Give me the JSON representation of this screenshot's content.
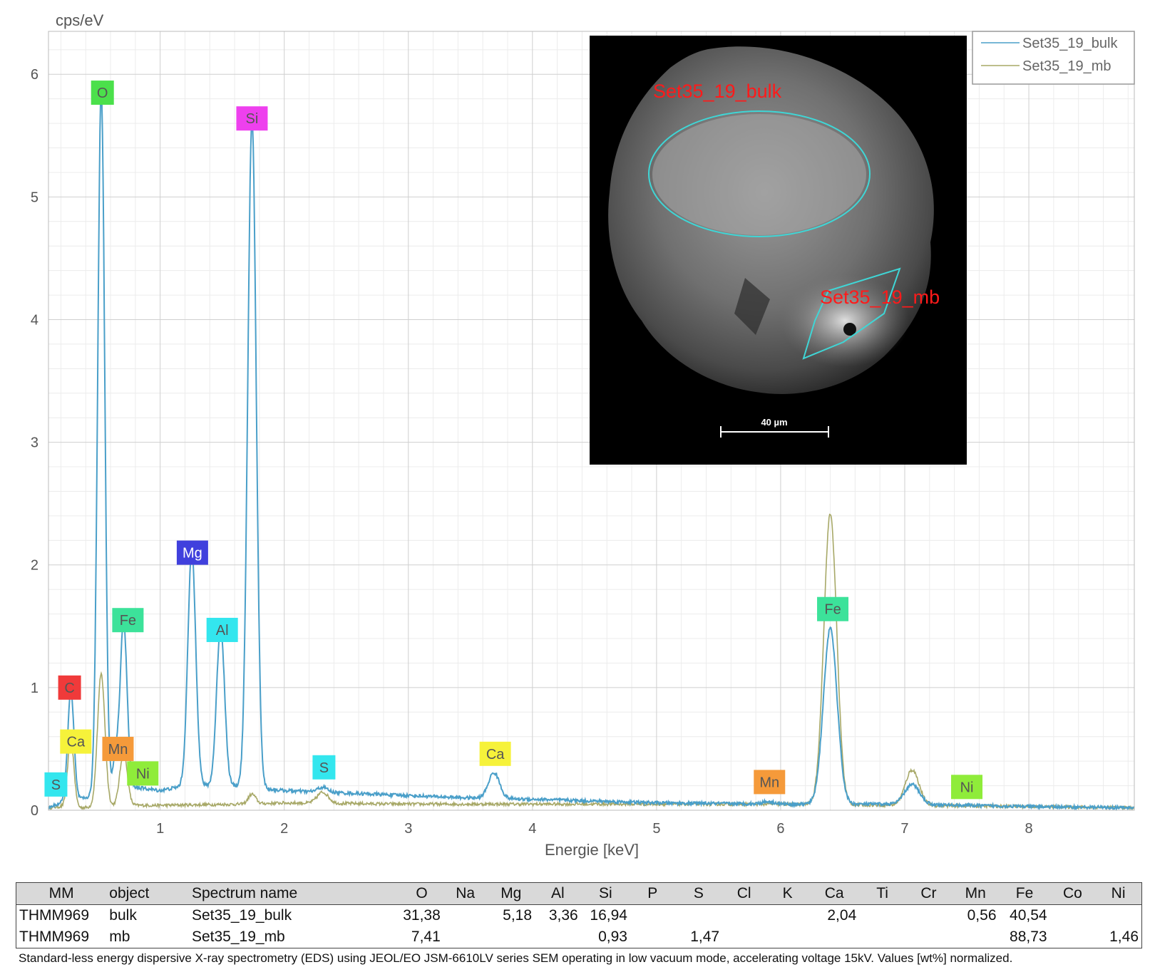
{
  "chart_data": {
    "type": "line",
    "xlabel": "Energie [keV]",
    "ylabel": "cps/eV",
    "xlim": [
      0.1,
      8.85
    ],
    "ylim": [
      0,
      6.35
    ],
    "x_ticks": [
      1,
      2,
      3,
      4,
      5,
      6,
      7,
      8
    ],
    "y_ticks": [
      0,
      1,
      2,
      3,
      4,
      5,
      6
    ],
    "grid": true,
    "legend_position": "top-right",
    "series": [
      {
        "name": "Set35_19_bulk",
        "color": "#4a9fc9",
        "baseline": [
          [
            0.1,
            0.02
          ],
          [
            0.2,
            0.06
          ],
          [
            0.4,
            0.1
          ],
          [
            0.7,
            0.2
          ],
          [
            1.0,
            0.16
          ],
          [
            1.2,
            0.2
          ],
          [
            1.6,
            0.2
          ],
          [
            1.9,
            0.17
          ],
          [
            2.0,
            0.16
          ],
          [
            2.5,
            0.14
          ],
          [
            3.0,
            0.12
          ],
          [
            3.5,
            0.1
          ],
          [
            4.0,
            0.09
          ],
          [
            5.0,
            0.06
          ],
          [
            6.0,
            0.05
          ],
          [
            7.0,
            0.05
          ],
          [
            8.0,
            0.03
          ],
          [
            8.85,
            0.02
          ]
        ],
        "peaks": [
          {
            "x": 0.28,
            "y": 0.9,
            "width": 0.025
          },
          {
            "x": 0.525,
            "y": 5.75,
            "width": 0.028
          },
          {
            "x": 0.64,
            "y": 0.25,
            "width": 0.02
          },
          {
            "x": 0.705,
            "y": 1.35,
            "width": 0.028
          },
          {
            "x": 1.255,
            "y": 1.92,
            "width": 0.032
          },
          {
            "x": 1.487,
            "y": 1.3,
            "width": 0.032
          },
          {
            "x": 1.74,
            "y": 5.45,
            "width": 0.034
          },
          {
            "x": 2.31,
            "y": 0.04,
            "width": 0.04
          },
          {
            "x": 3.69,
            "y": 0.21,
            "width": 0.045
          },
          {
            "x": 5.9,
            "y": 0.02,
            "width": 0.05
          },
          {
            "x": 6.4,
            "y": 1.43,
            "width": 0.055
          },
          {
            "x": 7.06,
            "y": 0.16,
            "width": 0.06
          }
        ]
      },
      {
        "name": "Set35_19_mb",
        "color": "#a7a867",
        "baseline": [
          [
            0.1,
            0.02
          ],
          [
            0.2,
            0.03
          ],
          [
            0.35,
            0.02
          ],
          [
            0.7,
            0.04
          ],
          [
            1.0,
            0.04
          ],
          [
            1.7,
            0.05
          ],
          [
            2.0,
            0.06
          ],
          [
            3.0,
            0.05
          ],
          [
            4.0,
            0.05
          ],
          [
            5.0,
            0.05
          ],
          [
            6.0,
            0.05
          ],
          [
            7.0,
            0.04
          ],
          [
            8.0,
            0.03
          ],
          [
            8.85,
            0.02
          ]
        ],
        "peaks": [
          {
            "x": 0.28,
            "y": 0.55,
            "width": 0.025
          },
          {
            "x": 0.525,
            "y": 1.08,
            "width": 0.03
          },
          {
            "x": 0.705,
            "y": 0.43,
            "width": 0.03
          },
          {
            "x": 1.74,
            "y": 0.08,
            "width": 0.03
          },
          {
            "x": 2.31,
            "y": 0.09,
            "width": 0.045
          },
          {
            "x": 6.4,
            "y": 2.37,
            "width": 0.052
          },
          {
            "x": 7.06,
            "y": 0.29,
            "width": 0.055
          }
        ]
      }
    ],
    "peak_labels": [
      {
        "text": "S",
        "x": 0.16,
        "y": 0.21,
        "color": "#33e6ee"
      },
      {
        "text": "C",
        "x": 0.27,
        "y": 1.0,
        "color": "#f03a3a"
      },
      {
        "text": "Ca",
        "x": 0.32,
        "y": 0.56,
        "color": "#f6f23a"
      },
      {
        "text": "O",
        "x": 0.535,
        "y": 5.85,
        "color": "#4be04b"
      },
      {
        "text": "Mn",
        "x": 0.66,
        "y": 0.5,
        "color": "#f59a3a"
      },
      {
        "text": "Fe",
        "x": 0.74,
        "y": 1.55,
        "color": "#3ce29a"
      },
      {
        "text": "Ni",
        "x": 0.86,
        "y": 0.3,
        "color": "#8fec3a"
      },
      {
        "text": "Mg",
        "x": 1.26,
        "y": 2.1,
        "color": "#4040dd"
      },
      {
        "text": "Al",
        "x": 1.5,
        "y": 1.47,
        "color": "#33e6ee"
      },
      {
        "text": "Si",
        "x": 1.74,
        "y": 5.64,
        "color": "#ee40ee"
      },
      {
        "text": "S",
        "x": 2.32,
        "y": 0.35,
        "color": "#33e6ee"
      },
      {
        "text": "Ca",
        "x": 3.7,
        "y": 0.46,
        "color": "#f6f23a"
      },
      {
        "text": "Mn",
        "x": 5.91,
        "y": 0.23,
        "color": "#f59a3a"
      },
      {
        "text": "Fe",
        "x": 6.42,
        "y": 1.64,
        "color": "#3ce29a"
      },
      {
        "text": "Ni",
        "x": 7.5,
        "y": 0.19,
        "color": "#8fec3a"
      }
    ]
  },
  "inset": {
    "region_labels": [
      "Set35_19_bulk",
      "Set35_19_mb"
    ],
    "scale_bar_label": "40 µm"
  },
  "table": {
    "headers": [
      "MM",
      "object",
      "Spectrum name",
      "O",
      "Na",
      "Mg",
      "Al",
      "Si",
      "P",
      "S",
      "Cl",
      "K",
      "Ca",
      "Ti",
      "Cr",
      "Mn",
      "Fe",
      "Co",
      "Ni"
    ],
    "rows": [
      [
        "THMM969",
        "bulk",
        "Set35_19_bulk",
        "31,38",
        "",
        "5,18",
        "3,36",
        "16,94",
        "",
        "",
        "",
        "",
        "2,04",
        "",
        "",
        "0,56",
        "40,54",
        "",
        ""
      ],
      [
        "THMM969",
        "mb",
        "Set35_19_mb",
        "7,41",
        "",
        "",
        "",
        "0,93",
        "",
        "1,47",
        "",
        "",
        "",
        "",
        "",
        "",
        "88,73",
        "",
        "1,46"
      ]
    ]
  },
  "caption": "Standard-less energy dispersive X-ray spectrometry (EDS) using JEOL/EO JSM-6610LV series SEM operating in low vacuum mode, accelerating voltage 15kV. Values [wt%] normalized."
}
